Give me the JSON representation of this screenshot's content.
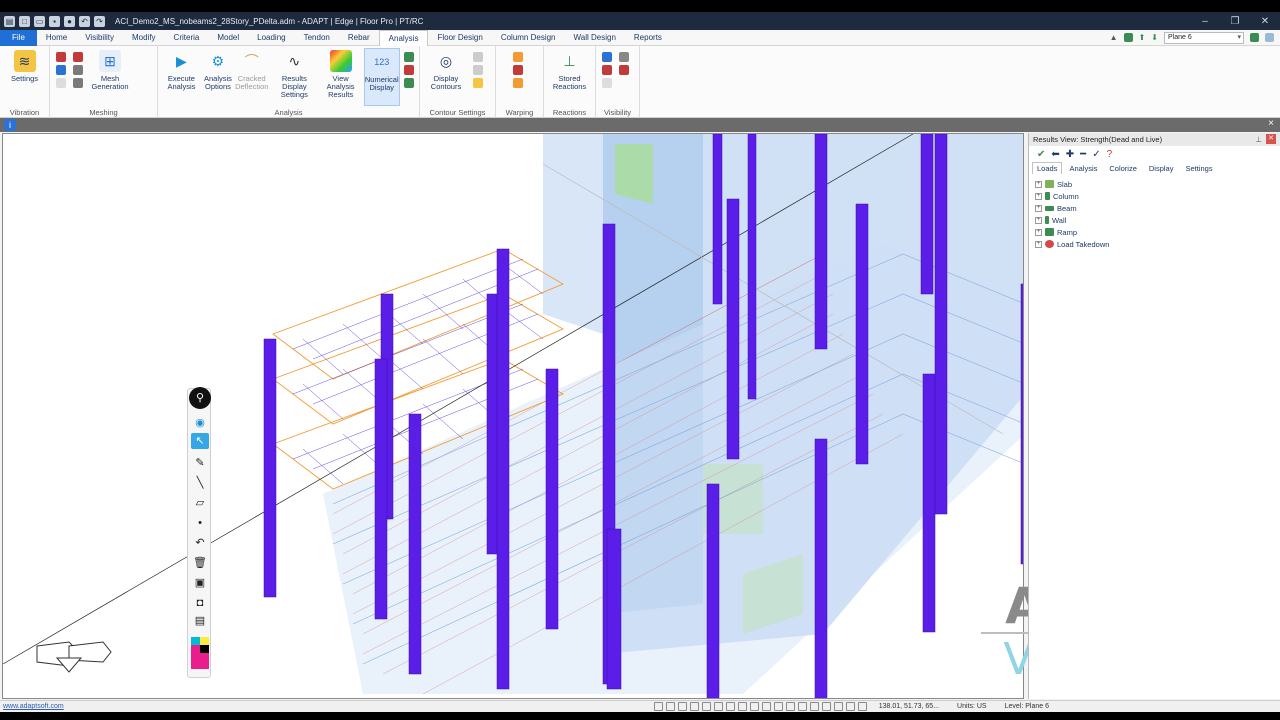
{
  "window": {
    "title": "ACI_Demo2_MS_nobeams2_28Story_PDelta.adm - ADAPT | Edge | Floor Pro | PT/RC",
    "controls": [
      "–",
      "❐",
      "✕"
    ]
  },
  "tabs": [
    "File",
    "Home",
    "Visibility",
    "Modify",
    "Criteria",
    "Model",
    "Loading",
    "Tendon",
    "Rebar",
    "Analysis",
    "Floor Design",
    "Column Design",
    "Wall Design",
    "Reports"
  ],
  "active_tab": "Analysis",
  "plane_select": "Plane 6",
  "ribbon": {
    "groups": [
      {
        "label": "Vibration",
        "buttons": [
          {
            "label": "Settings"
          }
        ]
      },
      {
        "label": "Meshing",
        "buttons": [
          {
            "label": "Mesh Generation"
          }
        ]
      },
      {
        "label": "Analysis",
        "buttons": [
          {
            "label": "Execute Analysis"
          },
          {
            "label": "Analysis Options"
          },
          {
            "label": "Cracked Deflection"
          },
          {
            "label": "Results Display Settings"
          },
          {
            "label": "View Analysis Results"
          },
          {
            "label": "Numerical Display"
          }
        ]
      },
      {
        "label": "Contour Settings",
        "buttons": [
          {
            "label": "Display Contours"
          }
        ]
      },
      {
        "label": "Warping",
        "buttons": []
      },
      {
        "label": "Reactions",
        "buttons": [
          {
            "label": "Stored Reactions"
          }
        ]
      },
      {
        "label": "Visibility",
        "buttons": []
      }
    ]
  },
  "panel": {
    "title": "Results View: Strength(Dead and Live)",
    "tabs": [
      "Loads",
      "Analysis",
      "Colorize",
      "Display",
      "Settings"
    ],
    "active_tab": "Loads",
    "tree": [
      "Slab",
      "Column",
      "Beam",
      "Wall",
      "Ramp",
      "Load Takedown"
    ]
  },
  "watermark": {
    "line1": "ADAPT",
    "line2": "VISICON"
  },
  "status": {
    "link": "www.adaptsoft.com",
    "coords": "138.01, 51.73, 65...",
    "units": "Units: US",
    "level": "Level: Plane 6"
  },
  "colors": {
    "column": "#5a1ee8",
    "slab_blue": "#a9c9ef",
    "mesh_purple": "#4b2bd6",
    "mesh_orange": "#f39b33",
    "tendon_red": "#d24a4a"
  }
}
